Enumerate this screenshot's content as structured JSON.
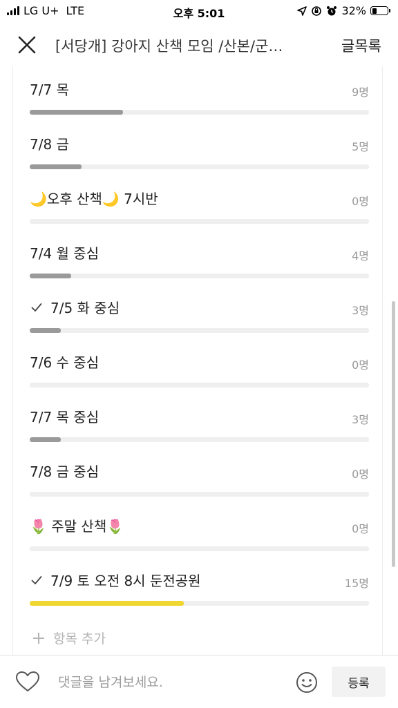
{
  "status_bar": {
    "carrier": "LG U+",
    "network": "LTE",
    "time": "오후 5:01",
    "battery": "32%",
    "battery_level": 0.32
  },
  "header": {
    "close_icon": "close-icon",
    "title": "[서당개] 강아지 산책 모임 /산본/군…",
    "list_link": "글목록"
  },
  "poll": {
    "options": [
      {
        "label": "7/7 목",
        "count": "9명",
        "ratio": 0.275,
        "checked": false,
        "winner": false
      },
      {
        "label": "7/8 금",
        "count": "5명",
        "ratio": 0.152,
        "checked": false,
        "winner": false
      },
      {
        "label": "🌙오후 산책🌙 7시반",
        "count": "0명",
        "ratio": 0,
        "checked": false,
        "winner": false
      },
      {
        "label": "7/4 월 중심",
        "count": "4명",
        "ratio": 0.122,
        "checked": false,
        "winner": false
      },
      {
        "label": "7/5 화 중심",
        "count": "3명",
        "ratio": 0.092,
        "checked": true,
        "winner": false
      },
      {
        "label": "7/6 수 중심",
        "count": "0명",
        "ratio": 0,
        "checked": false,
        "winner": false
      },
      {
        "label": "7/7 목 중심",
        "count": "3명",
        "ratio": 0.092,
        "checked": false,
        "winner": false
      },
      {
        "label": "7/8 금 중심",
        "count": "0명",
        "ratio": 0,
        "checked": false,
        "winner": false
      },
      {
        "label": "🌷 주말 산책🌷",
        "count": "0명",
        "ratio": 0,
        "checked": false,
        "winner": false
      },
      {
        "label": "7/9 토 오전 8시 둔전공원",
        "count": "15명",
        "ratio": 0.455,
        "checked": true,
        "winner": true
      }
    ],
    "add_item": "항목 추가",
    "colors": {
      "bar": "#9a9a9a",
      "winner_bar": "#f0d630"
    }
  },
  "comment_bar": {
    "heart_icon": "heart-outline-icon",
    "placeholder": "댓글을 남겨보세요.",
    "emoji_icon": "smiley-icon",
    "submit": "등록"
  }
}
